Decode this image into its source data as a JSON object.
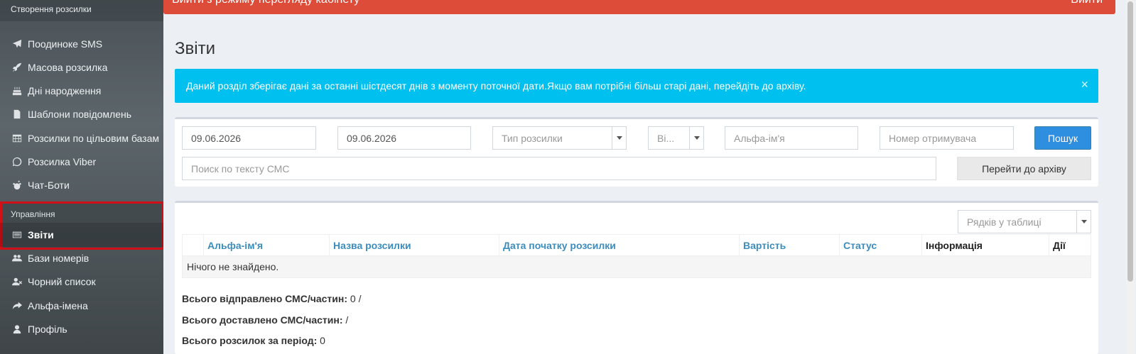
{
  "sidebar": {
    "section_create": "Створення розсилки",
    "items": [
      {
        "label": "Поодиноке SMS",
        "icon": "paper-plane-icon"
      },
      {
        "label": "Масова розсилка",
        "icon": "rocket-icon"
      },
      {
        "label": "Дні народження",
        "icon": "birthday-cake-icon"
      },
      {
        "label": "Шаблони повідомлень",
        "icon": "file-text-icon"
      },
      {
        "label": "Розсилки по цільовим базам",
        "icon": "table-icon"
      },
      {
        "label": "Розсилка Viber",
        "icon": "whatsapp-icon"
      },
      {
        "label": "Чат-Боти",
        "icon": "reddit-icon"
      }
    ],
    "section_manage": "Управління",
    "active_item": {
      "label": "Звіти",
      "icon": "list-alt-icon"
    },
    "items2": [
      {
        "label": "Бази номерів",
        "icon": "users-icon"
      },
      {
        "label": "Чорний список",
        "icon": "user-times-icon"
      },
      {
        "label": "Альфа-імена",
        "icon": "share-icon"
      },
      {
        "label": "Профіль",
        "icon": "user-icon"
      }
    ]
  },
  "topbar": {
    "title": "Вийти з режиму перегляду кабінету",
    "exit": "Вийти"
  },
  "page": {
    "title": "Звіти"
  },
  "alert": {
    "text": "Даний розділ зберігає дані за останні шістдесят днів з моменту поточної дати.Якщо вам потрібні більш старі дані, перейдіть до архіву.",
    "close": "×"
  },
  "filters": {
    "date_from": "09.06.2026",
    "date_to": "09.06.2026",
    "type_placeholder": "Тип розсилки",
    "short_select": "Ві...",
    "alpha_placeholder": "Альфа-ім'я",
    "recipient_placeholder": "Номер отримувача",
    "search_button": "Пошук",
    "text_search_placeholder": "Поиск по тексту СМС",
    "archive_button": "Перейти до архіву"
  },
  "table": {
    "rows_select": "Рядків у таблиці",
    "columns": [
      "Альфа-ім'я",
      "Назва розсилки",
      "Дата початку розсилки",
      "Вартість",
      "Статус",
      "Інформація",
      "Дії"
    ],
    "empty": "Нічого не знайдено."
  },
  "summary": {
    "sent_label": "Всього відправлено СМС/частин:",
    "sent_value": "0 /",
    "delivered_label": "Всього доставлено СМС/частин:",
    "delivered_value": "/",
    "mailings_label": "Всього розсилок за період:",
    "mailings_value": "0"
  }
}
